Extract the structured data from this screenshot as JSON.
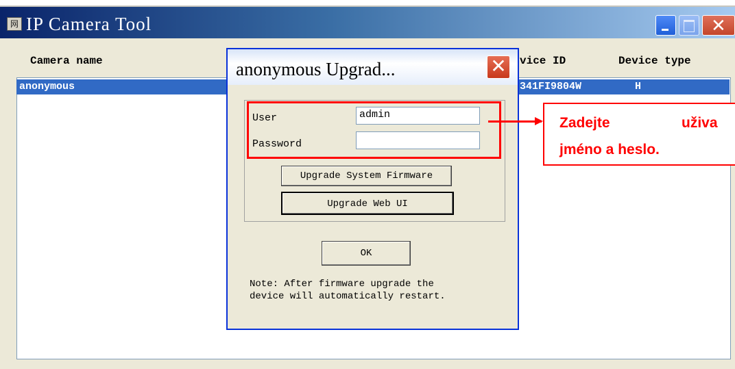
{
  "window": {
    "title": "IP Camera Tool",
    "icon_glyph": "网"
  },
  "list": {
    "columns": [
      "Camera name",
      "Device ID",
      "Device type"
    ],
    "column_partial_visible": "vice ID",
    "rows": [
      {
        "camera_name": "anonymous",
        "device_id_partial": "341FI9804W",
        "device_type": "H",
        "selected": true
      }
    ]
  },
  "dialog": {
    "title": "anonymous Upgrad...",
    "user_label": "User",
    "user_value": "admin",
    "password_label": "Password",
    "password_value": "",
    "upgrade_firmware_label": "Upgrade System Firmware",
    "upgrade_webui_label": "Upgrade Web UI",
    "ok_label": "OK",
    "note_line1": "Note: After firmware upgrade the",
    "note_line2": "device will automatically restart."
  },
  "callout": {
    "word1": "Zadejte",
    "word2": "uživa",
    "line2": "jméno a heslo."
  },
  "colors": {
    "selection": "#316ac5",
    "annotation_red": "#ff0000",
    "dialog_bg": "#ece9d8"
  }
}
